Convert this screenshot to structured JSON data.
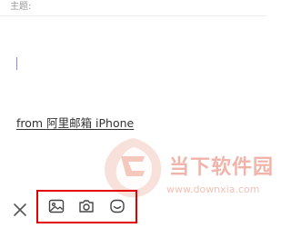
{
  "compose": {
    "subject_label": "主题:",
    "subject_value": "",
    "signature": "from 阿里邮箱 iPhone"
  },
  "watermark": {
    "title": "当下软件园",
    "url": "www.downxia.com"
  },
  "toolbar": {
    "close_icon": "close-icon",
    "buttons": [
      {
        "icon": "image-icon"
      },
      {
        "icon": "camera-icon"
      },
      {
        "icon": "emoji-icon"
      }
    ],
    "highlight_color": "#e30000"
  }
}
